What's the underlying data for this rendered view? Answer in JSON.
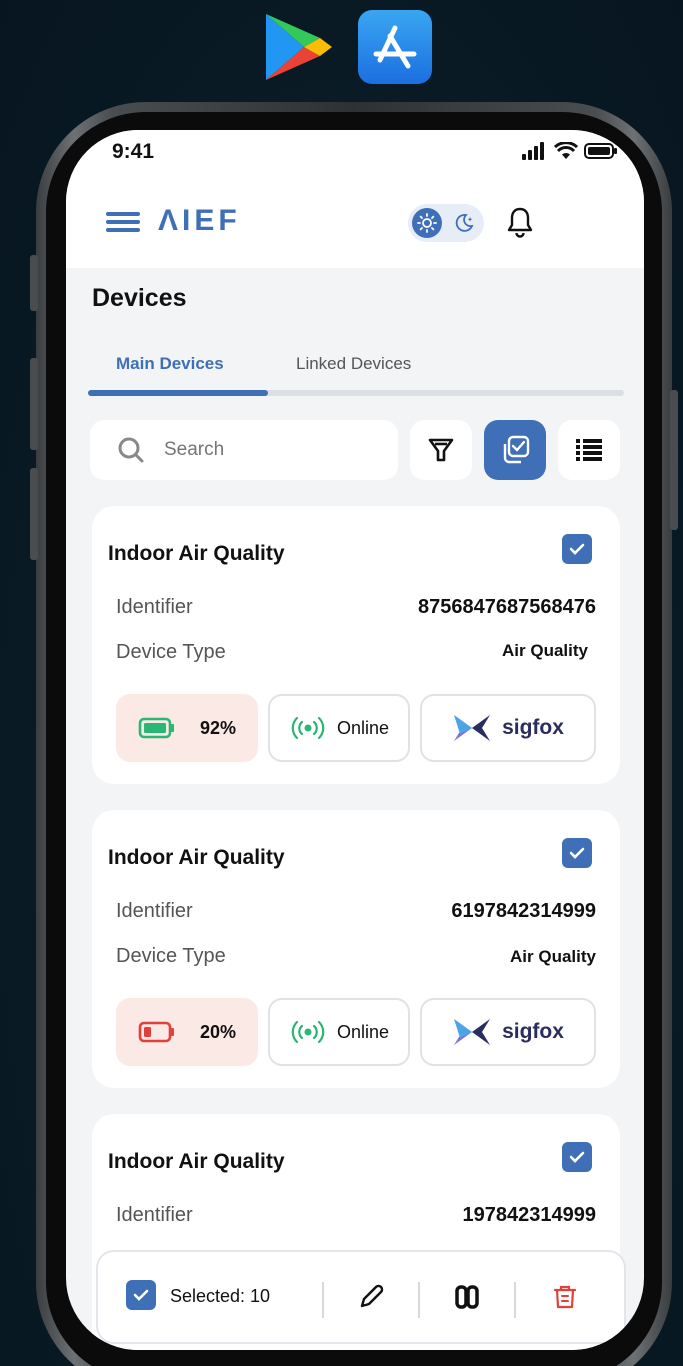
{
  "status_bar": {
    "time": "9:41"
  },
  "header": {
    "logo": "ΛIEF"
  },
  "page": {
    "title": "Devices"
  },
  "tabs": [
    {
      "label": "Main Devices",
      "active": true
    },
    {
      "label": "Linked Devices",
      "active": false
    }
  ],
  "search": {
    "placeholder": "Search"
  },
  "devices": [
    {
      "title": "Indoor Air Quality",
      "identifier_label": "Identifier",
      "identifier": "8756847687568476",
      "type_label": "Device Type",
      "type": "Air Quality",
      "battery": "92%",
      "battery_level": 0.92,
      "status": "Online",
      "network": "sigfox",
      "selected": true
    },
    {
      "title": "Indoor Air Quality",
      "identifier_label": "Identifier",
      "identifier": "6197842314999",
      "type_label": "Device Type",
      "type": "Air Quality",
      "battery": "20%",
      "battery_level": 0.2,
      "status": "Online",
      "network": "sigfox",
      "selected": true
    },
    {
      "title": "Indoor Air Quality",
      "identifier_label": "Identifier",
      "identifier": "197842314999",
      "selected": true
    }
  ],
  "bottom_bar": {
    "selected_label": "Selected: 10"
  },
  "colors": {
    "accent": "#3f6fb6",
    "battery_bg": "#fbe9e6",
    "battery_ok": "#2bb673",
    "battery_low": "#e0413a",
    "online": "#2bb673",
    "delete": "#e0413a",
    "screen_bg": "#f3f4f6"
  }
}
